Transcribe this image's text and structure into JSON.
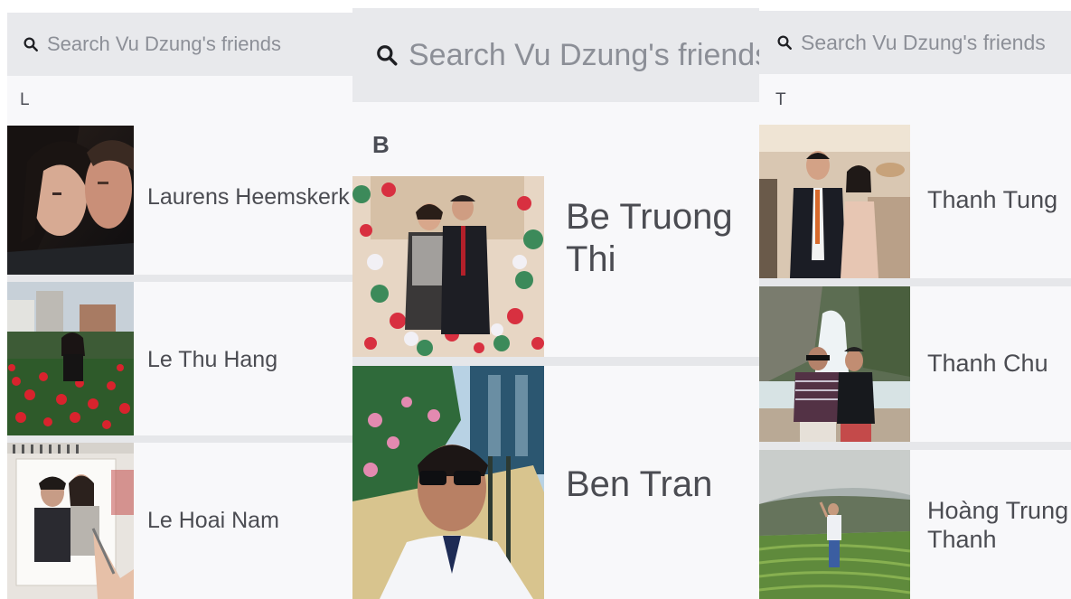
{
  "panels": [
    {
      "search": {
        "icon": "search-icon",
        "placeholder": "Search Vu Dzung's friends"
      },
      "section": "L",
      "friends": [
        {
          "name": "Laurens Heemskerk",
          "avatar": "couple-selfie-photo"
        },
        {
          "name": "Le Thu Hang",
          "avatar": "woman-in-flower-field-photo"
        },
        {
          "name": "Le Hoai Nam",
          "avatar": "sketch-frame-couple-photo"
        }
      ]
    },
    {
      "search": {
        "icon": "search-icon",
        "placeholder": "Search Vu Dzung's friends"
      },
      "section": "B",
      "friends": [
        {
          "name_line1": "Be Truong",
          "name_line2": "Thi",
          "avatar": "couple-in-flower-frame-photo"
        },
        {
          "name": "Ben Tran",
          "avatar": "man-with-sunglasses-selfie-photo"
        }
      ]
    },
    {
      "search": {
        "icon": "search-icon",
        "placeholder": "Search Vu Dzung's friends"
      },
      "section": "T",
      "friends": [
        {
          "name": "Thanh Tung",
          "avatar": "couple-at-event-photo"
        },
        {
          "name": "Thanh Chu",
          "avatar": "two-men-at-waterfall-photo"
        },
        {
          "name_line1": "Hoàng Trung",
          "name_line2": "Thanh",
          "avatar": "man-in-terraced-field-photo"
        }
      ]
    }
  ],
  "colors": {
    "panel_bg": "#f8f8fa",
    "search_bg": "#e8e9ec",
    "placeholder": "#8c8f97",
    "name_text": "#4b4c52",
    "separator": "#e6e7ea"
  }
}
